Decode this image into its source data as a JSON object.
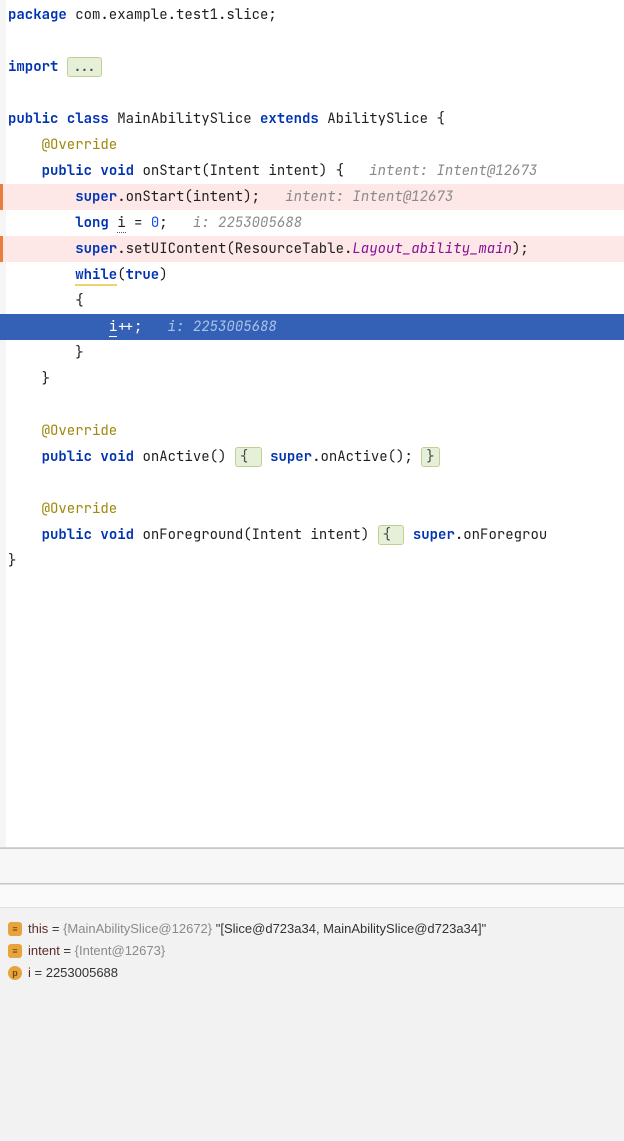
{
  "code": {
    "package_kw": "package",
    "package_name": " com.example.test1.slice;",
    "import_kw": "import",
    "import_fold": "...",
    "public": "public",
    "class_kw": "class",
    "class_name": "MainAbilitySlice",
    "extends_kw": "extends",
    "super_class": "AbilitySlice {",
    "override": "@Override",
    "void": "void",
    "onStart_sig": "onStart(Intent intent) {",
    "onStart_hint": "intent: Intent@12673",
    "super_kw": "super",
    "onStart_call": ".onStart(intent);",
    "onStart_call_hint": "intent: Intent@12673",
    "long_kw": "long",
    "i_decl_var": "i",
    "i_decl_rest": " = ",
    "zero": "0",
    "semicolon": ";",
    "i_decl_hint": "i: 2253005688",
    "setUI": ".setUIContent(ResourceTable.",
    "layout_field": "Layout_ability_main",
    "close_call": ");",
    "while_kw": "while",
    "true_kw": "true",
    "open_paren": "(",
    "close_paren": ")",
    "open_brace": "{",
    "close_brace": "}",
    "ipp_var": "i",
    "ipp_rest": "++;",
    "ipp_hint": "i: 2253005688",
    "onActive_sig": "onActive() ",
    "onActive_body_open": "{ ",
    "onActive_body_call": ".onActive(); ",
    "onActive_body_close": "}",
    "onFg_sig": "onForeground(Intent intent) ",
    "onFg_body": ".onForegrou"
  },
  "vars": {
    "this_name": "this",
    "this_eq": " = ",
    "this_type": "{MainAbilitySlice@12672}",
    "this_val": " \"[Slice@d723a34, MainAbilitySlice@d723a34]\"",
    "intent_name": "intent",
    "intent_eq": " = ",
    "intent_type": "{Intent@12673}",
    "i_name": "i",
    "i_eq": " = ",
    "i_val": "2253005688"
  },
  "icons": {
    "obj": "≡",
    "prim": "p"
  }
}
